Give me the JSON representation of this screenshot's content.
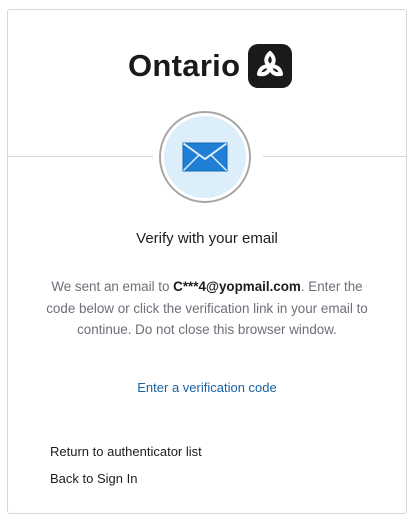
{
  "brand": {
    "logo_text": "Ontario",
    "logo_icon": "trillium-icon"
  },
  "authenticator": {
    "icon": "envelope-icon",
    "title": "Verify with your email",
    "desc_prefix": "We sent an email to ",
    "email": "C***4@yopmail.com",
    "desc_suffix": ". Enter the code below or click the verification link in your email to continue. Do not close this browser window.",
    "enter_code_link": "Enter a verification code"
  },
  "footer_links": {
    "return_to_list": "Return to authenticator list",
    "back_to_sign_in": "Back to Sign In"
  },
  "colors": {
    "link": "#1662a2",
    "envelope": "#1f7fd4",
    "beacon_fill": "#ddeefb"
  }
}
